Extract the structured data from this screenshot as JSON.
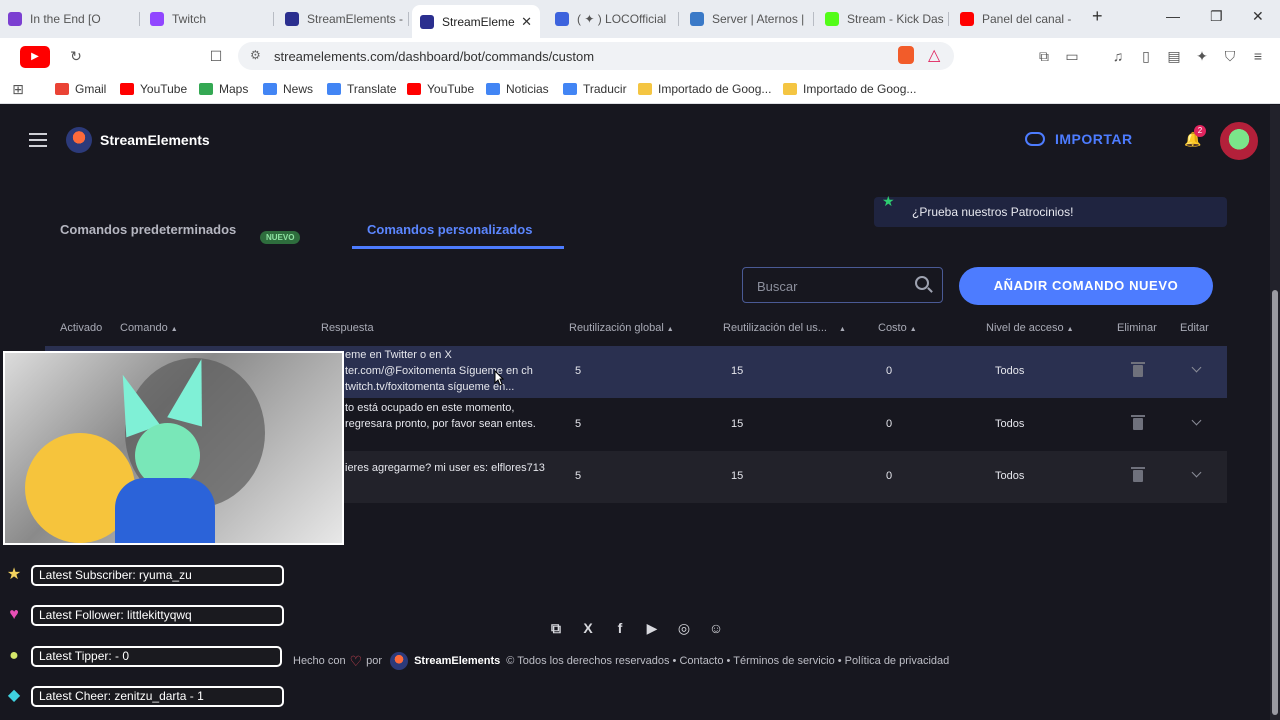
{
  "browser": {
    "tabs": [
      {
        "label": "In the End [O"
      },
      {
        "label": "Twitch"
      },
      {
        "label": "StreamElements -"
      },
      {
        "label": "StreamEleme",
        "active": true
      },
      {
        "label": "( ✦ ) LOCOfficial"
      },
      {
        "label": "Server | Aternos |"
      },
      {
        "label": "Stream - Kick Das"
      },
      {
        "label": "Panel del canal -"
      }
    ],
    "url": "streamelements.com/dashboard/bot/commands/custom",
    "bookmarks": [
      "Gmail",
      "YouTube",
      "Maps",
      "News",
      "Translate",
      "YouTube",
      "Noticias",
      "Traducir",
      "Importado de Goog...",
      "Importado de Goog..."
    ]
  },
  "header": {
    "brand": "StreamElements",
    "import_label": "IMPORTAR",
    "notif_count": "2"
  },
  "tabs": {
    "default_label": "Comandos predeterminados",
    "default_badge": "NUEVO",
    "custom_label": "Comandos personalizados"
  },
  "promo": {
    "text": "¿Prueba nuestros Patrocinios!"
  },
  "search": {
    "placeholder": "Buscar"
  },
  "add_button": {
    "label": "AÑADIR COMANDO NUEVO"
  },
  "table": {
    "headers": {
      "enabled": "Activado",
      "command": "Comando",
      "response": "Respuesta",
      "global_cd": "Reutilización global",
      "user_cd": "Reutilización del us...",
      "cost": "Costo",
      "access": "Nivel de acceso",
      "delete": "Eliminar",
      "edit": "Editar"
    },
    "rows": [
      {
        "response": "eme en Twitter o en X ter.com/@Foxitomenta Sígueme en ch twitch.tv/foxitomenta sígueme en...",
        "global": "5",
        "user": "15",
        "cost": "0",
        "access": "Todos"
      },
      {
        "response": "to está ocupado en este momento, regresara pronto, por favor sean entes.",
        "global": "5",
        "user": "15",
        "cost": "0",
        "access": "Todos"
      },
      {
        "response": "ieres agregarme? mi user es: elflores713",
        "global": "5",
        "user": "15",
        "cost": "0",
        "access": "Todos"
      }
    ]
  },
  "overlay": {
    "subscriber": "Latest Subscriber: ryuma_zu",
    "follower": "Latest Follower: littlekittyqwq",
    "tipper": "Latest Tipper:  -  0",
    "cheer": "Latest Cheer: zenitzu_darta - 1"
  },
  "footer": {
    "made_with": "Hecho con",
    "by": "por",
    "brand": "StreamElements",
    "rights": "© Todos los derechos reservados • Contacto • Términos de servicio • Política de privacidad"
  },
  "colors": {
    "accent": "#4d7cff",
    "background": "#17171f",
    "badge_green": "#2e6d3d"
  }
}
